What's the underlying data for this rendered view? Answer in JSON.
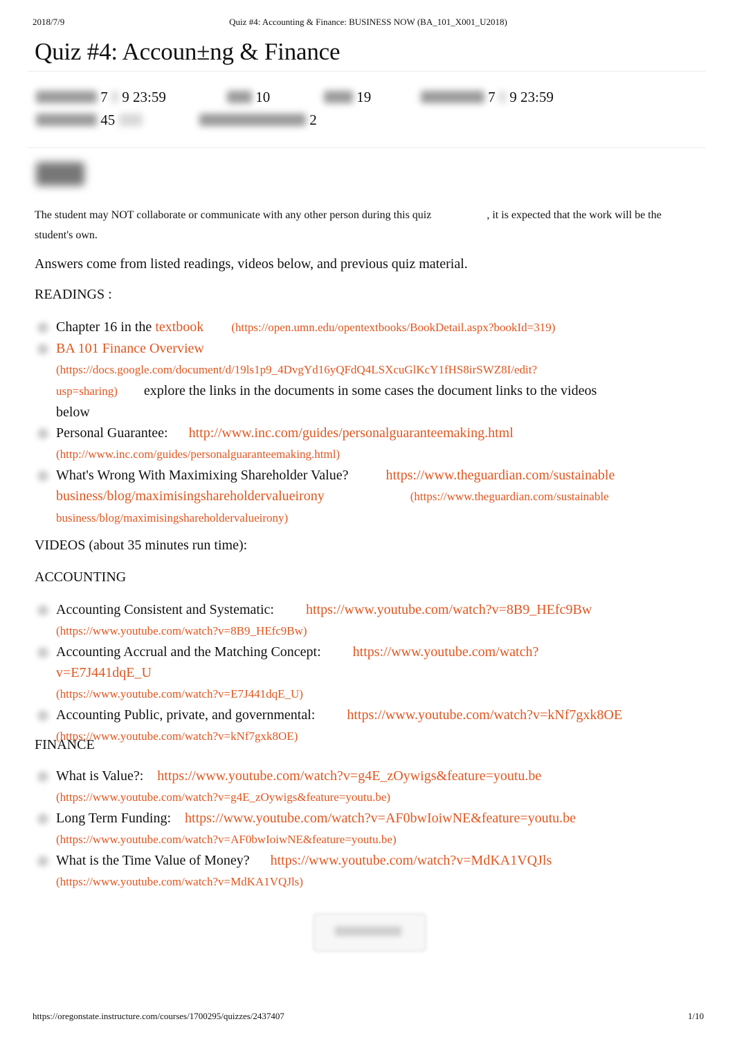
{
  "print_header": {
    "date": "2018/7/9",
    "doc_title": "Quiz #4: Accounting & Finance: BUSINESS NOW (BA_101_X001_U2018)"
  },
  "quiz": {
    "title": "Quiz #4: Accoun±ng & Finance",
    "details": {
      "due_month": "7",
      "due_rest": "9 23:59",
      "points": "10",
      "questions": "19",
      "available_month": "7",
      "available_rest": "9 23:59",
      "time_limit": "45",
      "allowed_attempts": "2"
    }
  },
  "body": {
    "policy_part1": "The student   may NOT collaborate or communicate with any other person during this quiz",
    "policy_part2": ", it is expected that the work will be the student's own.",
    "intro": "Answers come from listed readings, videos below, and previous quiz material.",
    "readings_heading": "READINGS :",
    "videos_heading": "VIDEOS (about 35 minutes run time):",
    "accounting_heading": "ACCOUNTING",
    "finance_heading": "FINANCE"
  },
  "readings": [
    {
      "label": "Chapter 16    in the ",
      "link_text": "textbook",
      "url_text": "(https://open.umn.edu/opentextbooks/BookDetail.aspx?bookId=319)"
    },
    {
      "link_text": "BA 101 Finance Overview",
      "url_text_1": "(https://docs.google.com/document/d/19ls1p9_4DvgYd16yQFdQ4LSXcuGlKcY1fHS8irSWZ8I/edit?",
      "url_text_2": "usp=sharing)",
      "trailing": "explore the links in the documents  in some cases the document links to the videos below"
    },
    {
      "label": "Personal Guarantee:",
      "link_text": "http://www.inc.com/guides/personalguaranteemaking.html",
      "url_text": "(http://www.inc.com/guides/personalguaranteemaking.html)"
    },
    {
      "label": "What's Wrong With Maximixing Shareholder Value?",
      "link_text_1": "https://www.theguardian.com/sustainable",
      "link_text_2": "business/blog/maximisingshareholdervalueirony",
      "url_text_1": "(https://www.theguardian.com/sustainable",
      "url_text_2": "business/blog/maximisingshareholdervalueirony)"
    }
  ],
  "accounting_videos": [
    {
      "label": "Accounting  Consistent and Systematic:",
      "link_text": "https://www.youtube.com/watch?v=8B9_HEfc9Bw",
      "url_text": "(https://www.youtube.com/watch?v=8B9_HEfc9Bw)"
    },
    {
      "label": "Accounting  Accrual and the Matching Concept:",
      "link_text": "https://www.youtube.com/watch?v=E7J441dqE_U",
      "url_text": "(https://www.youtube.com/watch?v=E7J441dqE_U)"
    },
    {
      "label": "Accounting  Public, private, and governmental:",
      "link_text": "https://www.youtube.com/watch?v=kNf7gxk8OE",
      "url_text": "(https://www.youtube.com/watch?v=kNf7gxk8OE)"
    }
  ],
  "finance_videos": [
    {
      "label": "What is Value?:",
      "link_text": "https://www.youtube.com/watch?v=g4E_zOywigs&feature=youtu.be",
      "url_text": "(https://www.youtube.com/watch?v=g4E_zOywigs&feature=youtu.be)"
    },
    {
      "label": "Long Term Funding:",
      "link_text": "https://www.youtube.com/watch?v=AF0bwIoiwNE&feature=youtu.be",
      "url_text": "(https://www.youtube.com/watch?v=AF0bwIoiwNE&feature=youtu.be)"
    },
    {
      "label": "What is the Time Value of Money?",
      "link_text": "https://www.youtube.com/watch?v=MdKA1VQJls",
      "url_text": "(https://www.youtube.com/watch?v=MdKA1VQJls)"
    }
  ],
  "print_footer": {
    "url": "https://oregonstate.instructure.com/courses/1700295/quizzes/2437407",
    "page": "1/10"
  },
  "colors": {
    "link": "#e0561f",
    "text": "#111111"
  }
}
